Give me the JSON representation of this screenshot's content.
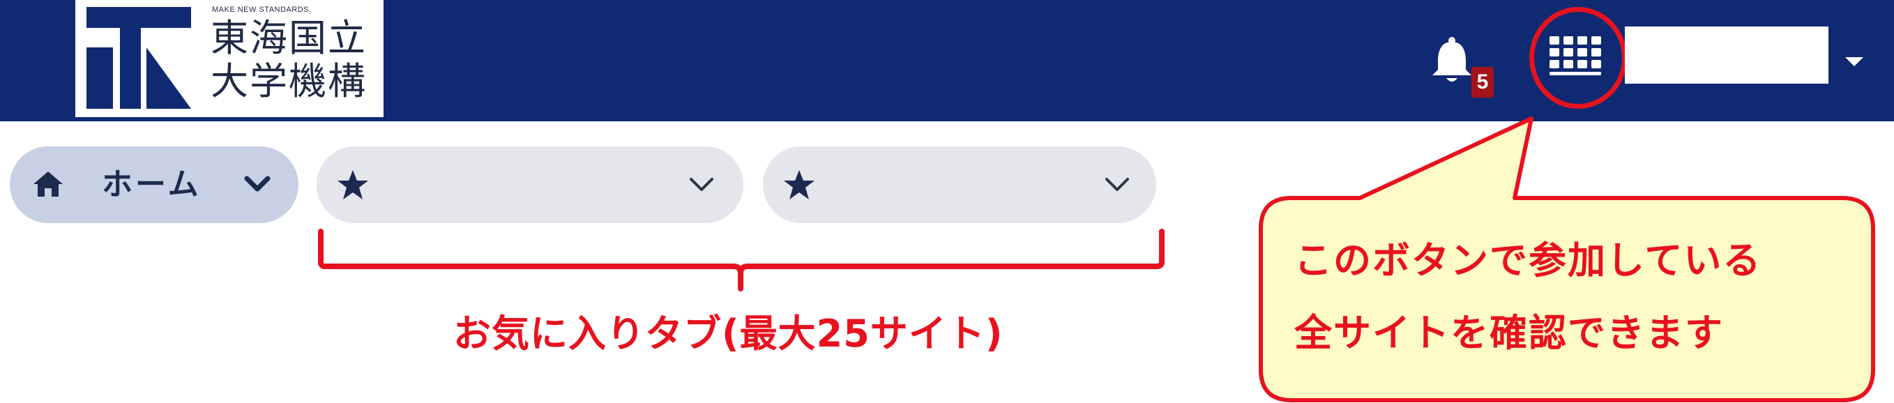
{
  "header": {
    "logo": {
      "tagline": "MAKE NEW STANDARDS.",
      "name_line1": "東海国立",
      "name_line2": "大学機構"
    },
    "notifications": {
      "icon": "bell-icon",
      "count": "5"
    },
    "apps_button": {
      "icon": "grid-icon"
    },
    "user_menu": {
      "name": "",
      "icon": "caret-down-icon"
    }
  },
  "tabs": [
    {
      "icon": "home-icon",
      "label": "ホーム",
      "chevron": "chevron-down-icon"
    },
    {
      "icon": "star-icon",
      "label": "",
      "chevron": "chevron-down-icon"
    },
    {
      "icon": "star-icon",
      "label": "",
      "chevron": "chevron-down-icon"
    }
  ],
  "annotations": {
    "favorites_caption": "お気に入りタブ(最大25サイト)",
    "callout_line1": "このボタンで参加している",
    "callout_line2": "全サイトを確認できます",
    "highlight_color": "#e8121f",
    "callout_fill": "#fffbc6"
  },
  "colors": {
    "header_bg": "#0f2a72",
    "home_tab_bg": "#c8d1e3",
    "tab_bg": "#e4e6ec"
  }
}
